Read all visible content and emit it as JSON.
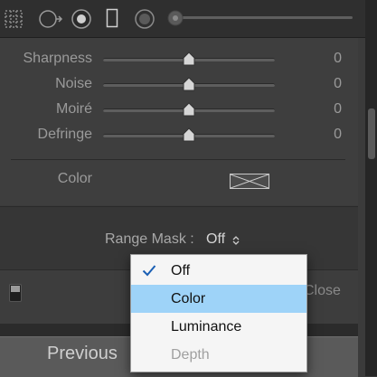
{
  "toolbar": {
    "icons": [
      "grid-icon",
      "circle-arrow-icon",
      "radial-filter-icon",
      "rectangle-icon",
      "spot-icon",
      "slider-knob-icon"
    ]
  },
  "detail": {
    "rows": [
      {
        "label": "Sharpness",
        "value": "0"
      },
      {
        "label": "Noise",
        "value": "0"
      },
      {
        "label": "Moiré",
        "value": "0"
      },
      {
        "label": "Defringe",
        "value": "0"
      }
    ],
    "color_label": "Color"
  },
  "range_mask": {
    "label": "Range Mask :",
    "value": "Off"
  },
  "bottom": {
    "close_label": "Close",
    "previous_label": "Previous"
  },
  "dropdown": {
    "items": [
      {
        "label": "Off",
        "checked": true,
        "highlighted": false,
        "disabled": false
      },
      {
        "label": "Color",
        "checked": false,
        "highlighted": true,
        "disabled": false
      },
      {
        "label": "Luminance",
        "checked": false,
        "highlighted": false,
        "disabled": false
      },
      {
        "label": "Depth",
        "checked": false,
        "highlighted": false,
        "disabled": true
      }
    ]
  },
  "colors": {
    "highlight": "#9ed3f8",
    "panel": "#3e3e3e",
    "label_text": "#9a9a9a"
  }
}
